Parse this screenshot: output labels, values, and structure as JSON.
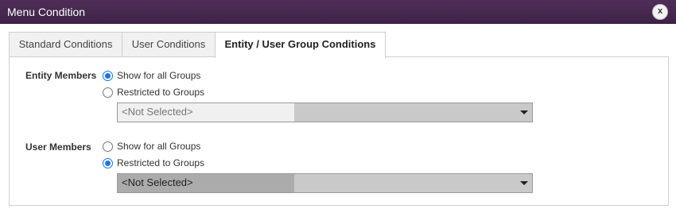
{
  "window": {
    "title": "Menu Condition",
    "close_label": "x"
  },
  "tabs": [
    {
      "label": "Standard Conditions",
      "active": false
    },
    {
      "label": "User Conditions",
      "active": false
    },
    {
      "label": "Entity / User Group Conditions",
      "active": true
    }
  ],
  "entity_members": {
    "label": "Entity Members",
    "options": [
      {
        "label": "Show for all Groups",
        "checked": true
      },
      {
        "label": "Restricted to Groups",
        "checked": false
      }
    ],
    "select_value": "<Not Selected>"
  },
  "user_members": {
    "label": "User Members",
    "options": [
      {
        "label": "Show for all Groups",
        "checked": false
      },
      {
        "label": "Restricted to Groups",
        "checked": true
      }
    ],
    "select_value": "<Not Selected>"
  },
  "colors": {
    "titlebar": "#3e2347",
    "radio_accent": "#1a73e8"
  }
}
